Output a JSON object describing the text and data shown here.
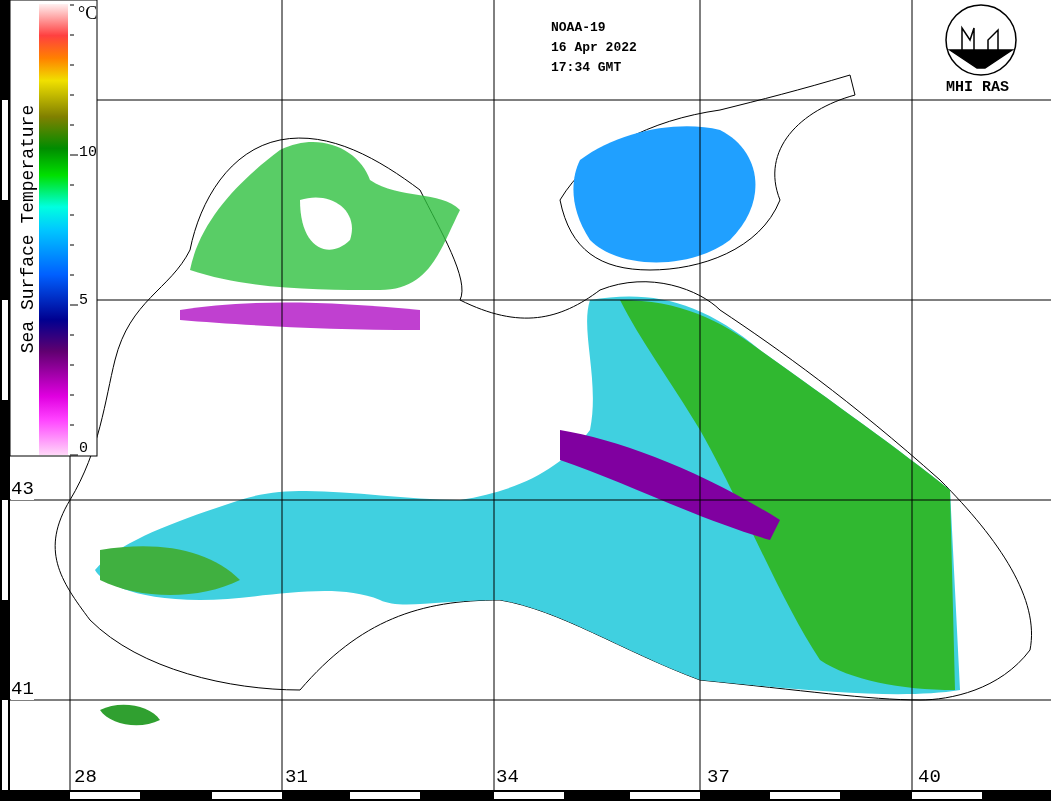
{
  "colorbar": {
    "title": "Sea Surface Temperature",
    "unit": "°C",
    "ticks": [
      "10",
      "5",
      "0"
    ]
  },
  "header": {
    "satellite": "NOAA-19",
    "date": "16 Apr 2022",
    "time": "17:34 GMT"
  },
  "logo": {
    "label": "MHI RAS"
  },
  "latitude_labels": [
    "43",
    "41"
  ],
  "longitude_labels": [
    "28",
    "31",
    "34",
    "37",
    "40"
  ]
}
